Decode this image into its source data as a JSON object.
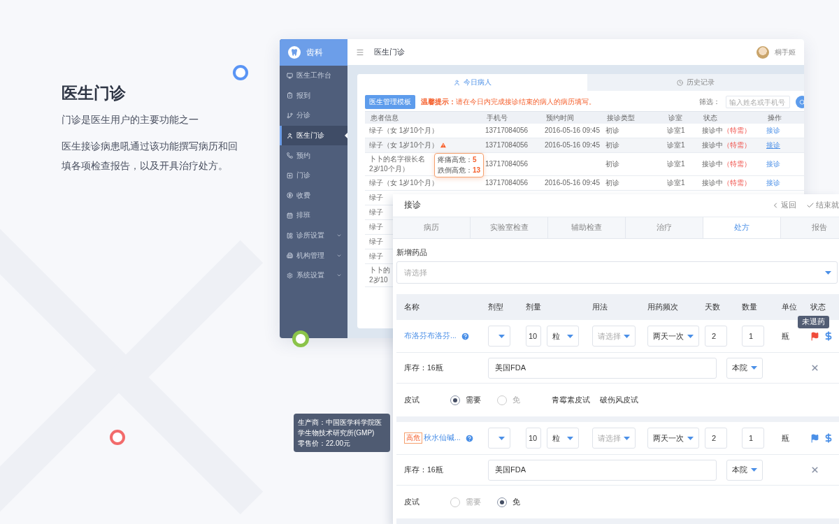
{
  "intro": {
    "title": "医生门诊",
    "subtitle": "门诊是医生用户的主要功能之一",
    "body": "医生接诊病患吼通过该功能撰写病历和回填各项检查报告，以及开具治疗处方。"
  },
  "app": {
    "brand": "齿科",
    "page_title": "医生门诊",
    "user": "桐手姬",
    "sidebar": [
      {
        "label": "医生工作台",
        "selected": false,
        "has_submenu": false
      },
      {
        "label": "报到",
        "selected": false,
        "has_submenu": false
      },
      {
        "label": "分诊",
        "selected": false,
        "has_submenu": false
      },
      {
        "label": "医生门诊",
        "selected": true,
        "has_submenu": false
      },
      {
        "label": "预约",
        "selected": false,
        "has_submenu": false
      },
      {
        "label": "门诊",
        "selected": false,
        "has_submenu": false
      },
      {
        "label": "收费",
        "selected": false,
        "has_submenu": false
      },
      {
        "label": "排班",
        "selected": false,
        "has_submenu": false
      },
      {
        "label": "诊所设置",
        "selected": false,
        "has_submenu": true
      },
      {
        "label": "机构管理",
        "selected": false,
        "has_submenu": true
      },
      {
        "label": "系统设置",
        "selected": false,
        "has_submenu": true
      }
    ],
    "tabs": [
      {
        "label": "今日病人",
        "selected": true
      },
      {
        "label": "历史记录",
        "selected": false
      }
    ],
    "template_button": "医生管理模板",
    "notice_label": "温馨提示：",
    "notice": "请在今日内完成接诊结束的病人的病历填写。",
    "filter_label": "筛选：",
    "filter_placeholder": "输入姓名或手机号",
    "columns": [
      "患者信息",
      "手机号",
      "预约时间",
      "接诊类型",
      "诊室",
      "状态",
      "操作"
    ],
    "rows": [
      {
        "patient": "绿子（女 1岁10个月）",
        "warning": false,
        "hovered": false,
        "phone": "13717084056",
        "time": "2016-05-16 09:45",
        "type": "初诊",
        "room": "诊室1",
        "status": "接诊中",
        "status_note": "（特需）",
        "action": "接诊"
      },
      {
        "patient": "绿子（女 1岁10个月）",
        "warning": true,
        "hovered": true,
        "phone": "13717084056",
        "time": "2016-05-16 09:45",
        "type": "初诊",
        "room": "诊室1",
        "status": "接诊中",
        "status_note": "（特需）",
        "action": "接诊"
      },
      {
        "patient": "卜卜的名字很长名",
        "patient_line2": "2岁10个月）",
        "warning": false,
        "hovered": false,
        "phone": "13717084056",
        "type": "初诊",
        "room": "诊室1",
        "status": "接诊中",
        "status_note": "（特需）",
        "action": "接诊"
      },
      {
        "patient": "绿子（女 1岁10个月）",
        "warning": false,
        "hovered": false,
        "phone": "13717084056",
        "time": "2016-05-16 09:45",
        "type": "初诊",
        "room": "诊室1",
        "status": "接诊中",
        "status_note": "（特需）",
        "action": "接诊"
      },
      {
        "patient": "绿子",
        "warning": false,
        "hovered": false
      },
      {
        "patient": "绿子",
        "warning": false,
        "hovered": false
      },
      {
        "patient": "绿子",
        "warning": false,
        "hovered": false
      },
      {
        "patient": "绿子",
        "warning": false,
        "hovered": false
      },
      {
        "patient": "绿子",
        "warning": false,
        "hovered": false
      },
      {
        "patient": "卜卜的",
        "patient_line2": "2岁10",
        "warning": false,
        "hovered": false
      }
    ],
    "risk_popup": [
      {
        "label": "疼痛高危：",
        "value": "5"
      },
      {
        "label": "跌倒高危：",
        "value": "13"
      }
    ]
  },
  "dialog": {
    "title": "接诊",
    "back": "返回",
    "finish": "结束就",
    "tabs": [
      {
        "label": "病历",
        "selected": false
      },
      {
        "label": "实验室检查",
        "selected": false
      },
      {
        "label": "辅助检查",
        "selected": false
      },
      {
        "label": "治疗",
        "selected": false
      },
      {
        "label": "处方",
        "selected": true
      },
      {
        "label": "报告",
        "selected": false
      }
    ],
    "add_label": "新增药品",
    "add_placeholder": "请选择",
    "columns": [
      "名称",
      "剂型",
      "剂量",
      "用法",
      "用药频次",
      "天数",
      "数量",
      "单位",
      "状态"
    ],
    "drugs": [
      {
        "name": "布洛芬布洛芬...",
        "dose": "10",
        "dose_unit": "粒",
        "usage_placeholder": "请选择",
        "frequency": "两天一次",
        "days": "2",
        "quantity": "1",
        "unit": "瓶",
        "color": "#f04b3a",
        "flag_tooltip": "未退药",
        "stock": "库存：16瓶",
        "origin": "美国FDA",
        "source": "本院",
        "skin_label": "皮试",
        "skin_options": [
          {
            "label": "需要",
            "selected": true
          },
          {
            "label": "免",
            "selected": false
          }
        ],
        "tests": [
          "青霉素皮试",
          "破伤风皮试"
        ]
      },
      {
        "risk_tag": "高危",
        "name": "秋水仙碱...",
        "dose": "10",
        "dose_unit": "粒",
        "usage_placeholder": "请选择",
        "frequency": "两天一次",
        "days": "2",
        "quantity": "1",
        "unit": "瓶",
        "color": "#4a8fe7",
        "manufacturer": "生产商：中国医学科学院医学生物技术研究所(GMP)",
        "price": "零售价：22.00元",
        "stock": "库存：16瓶",
        "origin": "美国FDA",
        "source": "本院",
        "skin_label": "皮试",
        "skin_options": [
          {
            "label": "需要",
            "selected": false
          },
          {
            "label": "免",
            "selected": true
          }
        ]
      }
    ]
  }
}
